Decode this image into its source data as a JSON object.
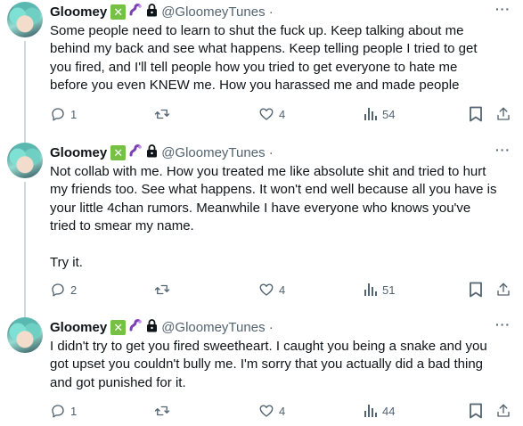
{
  "tweets": [
    {
      "name": "Gloomey",
      "badge": "✕",
      "handle": "@GloomeyTunes ·",
      "more": "···",
      "text": "Some people need to learn to shut the fuck up. Keep talking about me\nbehind my back and see what happens. Keep telling people I tried to get\nyou fired, and I'll tell people how you tried to get everyone to hate me\nbefore you even KNEW me. How you harassed me and made people",
      "replies": "1",
      "likes": "4",
      "views": "54"
    },
    {
      "name": "Gloomey",
      "badge": "✕",
      "handle": "@GloomeyTunes ·",
      "more": "···",
      "text": "Not collab with me. How you treated me like absolute shit and tried to hurt\nmy friends too. See what happens. It won't end well because all you have is\nyour little 4chan rumors. Meanwhile I have everyone who knows you've\ntried to smear my name.\n\nTry it.",
      "replies": "2",
      "likes": "4",
      "views": "51"
    },
    {
      "name": "Gloomey",
      "badge": "✕",
      "handle": "@GloomeyTunes ·",
      "more": "···",
      "text": "I didn't try to get you fired sweetheart. I caught you being a snake and you\ngot upset you couldn't bully me. I'm sorry that you actually did a bad thing\nand got punished for it.",
      "replies": "1",
      "likes": "4",
      "views": "44"
    }
  ],
  "colors": {
    "text": "#0f1419",
    "secondary": "#536471",
    "thread_line": "#cfd9de",
    "badge_green": "#76c043",
    "worm_purple": "#7b3fb5"
  }
}
